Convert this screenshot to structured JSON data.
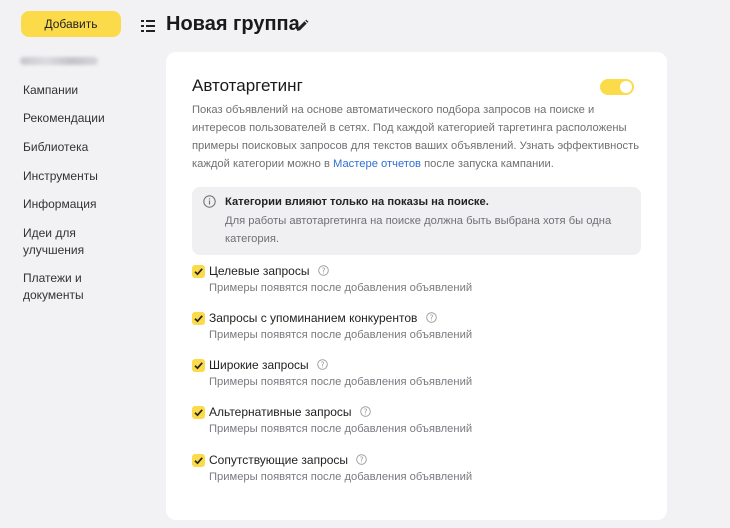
{
  "sidebar": {
    "add_button": "Добавить",
    "items": [
      {
        "label": "Кампании"
      },
      {
        "label": "Рекомендации"
      },
      {
        "label": "Библиотека"
      },
      {
        "label": "Инструменты"
      },
      {
        "label": "Информация"
      },
      {
        "label": "Идеи для улучшения"
      },
      {
        "label": "Платежи и документы"
      }
    ]
  },
  "header": {
    "title": "Новая группа",
    "menu_icon": "list-icon",
    "edit_icon": "pencil-icon"
  },
  "card": {
    "title": "Автотаргетинг",
    "toggle_on": true,
    "description_before_link": "Показ объявлений на основе автоматического подбора запросов на поиске и интересов пользователей в сетях. Под каждой категорией таргетинга расположены примеры поисковых запросов для текстов ваших объявлений. Узнать эффективность каждой категории можно в ",
    "description_link": "Мастере отчетов",
    "description_after_link": " после запуска кампании.",
    "info": {
      "icon": "info-icon",
      "title": "Категории влияют только на показы на поиске.",
      "text": "Для работы автотаргетинга на поиске должна быть выбрана хотя бы одна категория."
    },
    "options": [
      {
        "label": "Целевые запросы",
        "sub": "Примеры появятся после добавления объявлений",
        "checked": true
      },
      {
        "label": "Запросы с упоминанием конкурентов",
        "sub": "Примеры появятся после добавления объявлений",
        "checked": true
      },
      {
        "label": "Широкие запросы",
        "sub": "Примеры появятся после добавления объявлений",
        "checked": true
      },
      {
        "label": "Альтернативные запросы",
        "sub": "Примеры появятся после добавления объявлений",
        "checked": true
      },
      {
        "label": "Сопутствующие запросы",
        "sub": "Примеры появятся после добавления объявлений",
        "checked": true
      }
    ]
  },
  "colors": {
    "accent": "#fcdb4b",
    "link": "#2f6fd6",
    "background": "#f2f2f4"
  }
}
